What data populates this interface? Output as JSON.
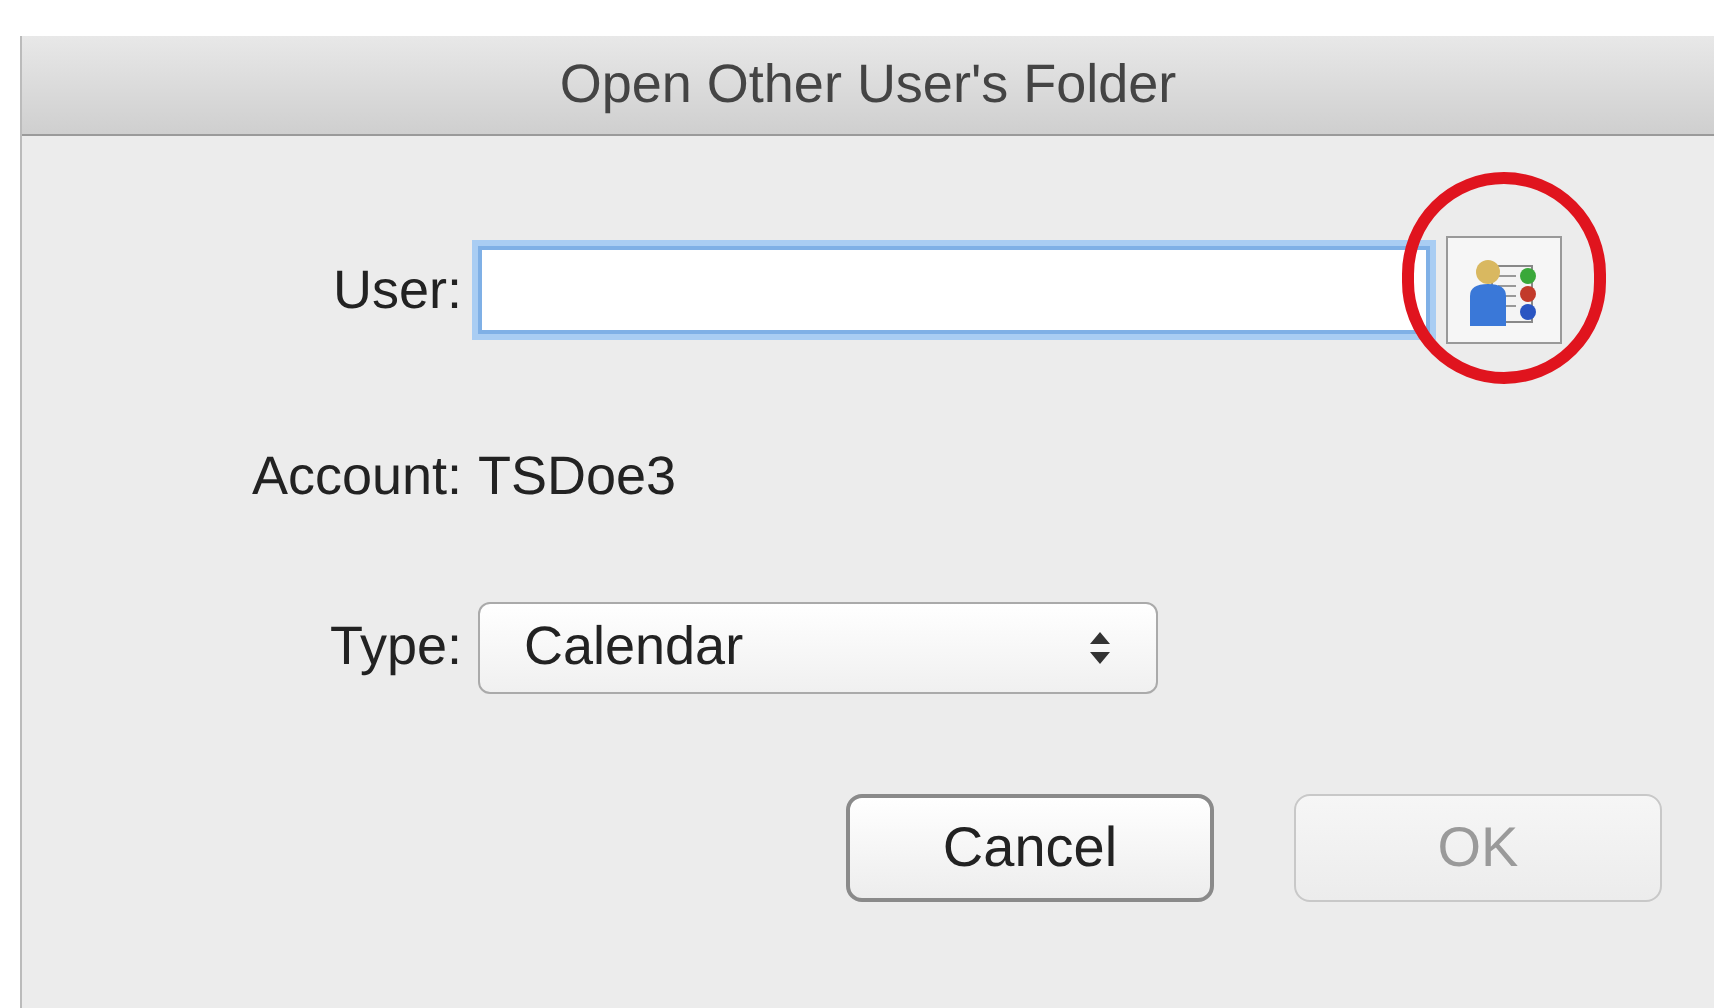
{
  "window": {
    "title": "Open Other User's Folder"
  },
  "user": {
    "label": "User:",
    "focused": true,
    "address_book_circled": true
  },
  "account": {
    "label": "Account:",
    "value": "TSDoe3"
  },
  "type": {
    "label": "Type:",
    "value": "Calendar"
  },
  "buttons": [
    {
      "label": "Cancel",
      "disabled": false
    },
    {
      "label": "OK",
      "disabled": true
    }
  ]
}
